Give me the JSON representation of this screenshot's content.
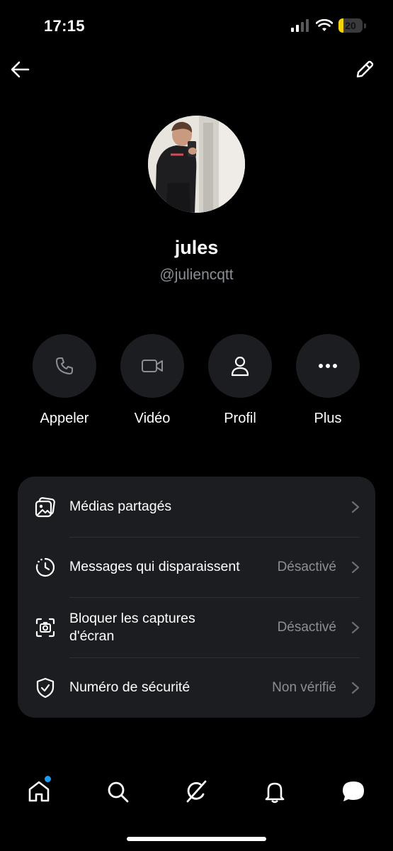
{
  "status_bar": {
    "time": "17:15",
    "battery_level": "20",
    "battery_color": "#f5d20a"
  },
  "top_bar": {
    "back_icon": "arrow-left-icon",
    "edit_icon": "pencil-icon"
  },
  "profile": {
    "name": "jules",
    "handle": "@juliencqtt"
  },
  "actions": [
    {
      "label": "Appeler",
      "icon": "phone-icon"
    },
    {
      "label": "Vidéo",
      "icon": "video-camera-icon"
    },
    {
      "label": "Profil",
      "icon": "person-icon"
    },
    {
      "label": "Plus",
      "icon": "more-dots-icon"
    }
  ],
  "settings": [
    {
      "title": "Médias partagés",
      "value": "",
      "icon": "media-gallery-icon"
    },
    {
      "title": "Messages qui disparaissent",
      "value": "Désactivé",
      "icon": "timer-icon"
    },
    {
      "title": "Bloquer les captures d'écran",
      "value": "Désactivé",
      "icon": "screenshot-camera-icon"
    },
    {
      "title": "Numéro de sécurité",
      "value": "Non vérifié",
      "icon": "shield-check-icon"
    }
  ],
  "bottom_nav": [
    {
      "icon": "home-icon",
      "has_notification_dot": true
    },
    {
      "icon": "search-icon"
    },
    {
      "icon": "grok-icon"
    },
    {
      "icon": "bell-icon"
    },
    {
      "icon": "messages-icon"
    }
  ],
  "colors": {
    "background": "#000000",
    "card": "#1c1d20",
    "secondary_text": "#8b8f95",
    "accent": "#1d9bf0"
  }
}
